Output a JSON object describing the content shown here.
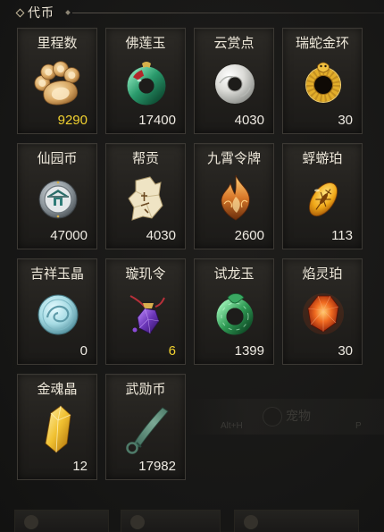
{
  "header": {
    "title": "代币"
  },
  "items": [
    {
      "name": "里程数",
      "count": "9290",
      "count_color": "#f2d230",
      "icon": "paw-cookie-icon"
    },
    {
      "name": "佛莲玉",
      "count": "17400",
      "count_color": "#efebe3",
      "icon": "green-jade-ring-icon"
    },
    {
      "name": "云赏点",
      "count": "4030",
      "count_color": "#efebe3",
      "icon": "white-jade-ring-icon"
    },
    {
      "name": "瑞蛇金环",
      "count": "30",
      "count_color": "#efebe3",
      "icon": "golden-snake-ring-icon"
    },
    {
      "name": "仙园币",
      "count": "47000",
      "count_color": "#efebe3",
      "icon": "silver-coin-icon"
    },
    {
      "name": "帮贡",
      "count": "4030",
      "count_color": "#efebe3",
      "icon": "paper-scroll-icon"
    },
    {
      "name": "九霄令牌",
      "count": "2600",
      "count_color": "#efebe3",
      "icon": "flame-token-icon"
    },
    {
      "name": "蜉蝣珀",
      "count": "113",
      "count_color": "#efebe3",
      "icon": "amber-insect-icon"
    },
    {
      "name": "吉祥玉晶",
      "count": "0",
      "count_color": "#efebe3",
      "icon": "blue-jade-disk-icon"
    },
    {
      "name": "璇玑令",
      "count": "6",
      "count_color": "#f2d230",
      "icon": "purple-pendant-icon"
    },
    {
      "name": "试龙玉",
      "count": "1399",
      "count_color": "#efebe3",
      "icon": "green-dragon-jade-icon"
    },
    {
      "name": "焰灵珀",
      "count": "30",
      "count_color": "#efebe3",
      "icon": "red-flame-gem-icon"
    },
    {
      "name": "金魂晶",
      "count": "12",
      "count_color": "#efebe3",
      "icon": "golden-crystal-icon"
    },
    {
      "name": "武勋币",
      "count": "17982",
      "count_color": "#efebe3",
      "icon": "green-knife-coin-icon"
    }
  ],
  "background_hints": {
    "pet_label": "宠物",
    "pet_hotkey": "Alt+H",
    "p_key": "P"
  },
  "colors": {
    "background": "#171716",
    "tile_border": "#3c3934",
    "label": "#ede7d9",
    "count": "#efebe3",
    "highlight_count": "#f2d230"
  }
}
